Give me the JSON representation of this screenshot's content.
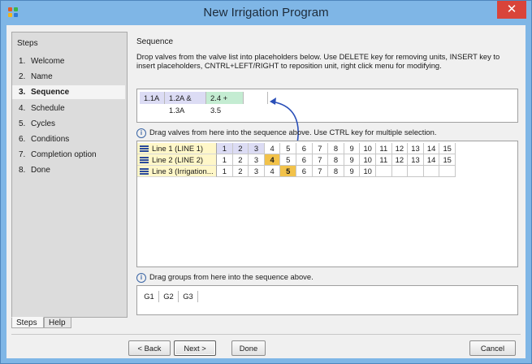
{
  "window": {
    "title": "New Irrigation Program",
    "close_icon": "✕",
    "title_bar_color": "#7fb6e6",
    "close_color": "#d9443a"
  },
  "steps": {
    "title": "Steps",
    "items": [
      {
        "num": "1.",
        "label": "Welcome",
        "active": false
      },
      {
        "num": "2.",
        "label": "Name",
        "active": false
      },
      {
        "num": "3.",
        "label": "Sequence",
        "active": true
      },
      {
        "num": "4.",
        "label": "Schedule",
        "active": false
      },
      {
        "num": "5.",
        "label": "Cycles",
        "active": false
      },
      {
        "num": "6.",
        "label": "Conditions",
        "active": false
      },
      {
        "num": "7.",
        "label": "Completion option",
        "active": false
      },
      {
        "num": "8.",
        "label": "Done",
        "active": false
      }
    ],
    "tabs": [
      {
        "label": "Steps",
        "selected": true
      },
      {
        "label": "Help",
        "selected": false
      }
    ]
  },
  "sequence": {
    "title": "Sequence",
    "instructions": "Drop valves from the valve list into placeholders below. Use DELETE key for removing units, INSERT key to insert placeholders, CNTRL+LEFT/RIGHT to reposition unit, right click menu for modifying.",
    "chips": [
      {
        "label": "1.1A",
        "color": "#dcdcf4"
      },
      {
        "label": "1.2A & 1.3A",
        "color": "#dcdcf4"
      },
      {
        "label": "2.4 + 3.5",
        "color": "#c4ecd2"
      }
    ]
  },
  "valves": {
    "hint": "Drag valves from here into the sequence above. Use CTRL key for multiple selection.",
    "highlight_color": "#f2c24a",
    "lines": [
      {
        "name": "Line 1 (LINE  1)",
        "cells": [
          "1",
          "2",
          "3",
          "4",
          "5",
          "6",
          "7",
          "8",
          "9",
          "10",
          "11",
          "12",
          "13",
          "14",
          "15"
        ],
        "highlight": -1,
        "lavender": [
          0,
          1,
          2
        ]
      },
      {
        "name": "Line 2 (LINE  2)",
        "cells": [
          "1",
          "2",
          "3",
          "4",
          "5",
          "6",
          "7",
          "8",
          "9",
          "10",
          "11",
          "12",
          "13",
          "14",
          "15"
        ],
        "highlight": 3,
        "lavender": []
      },
      {
        "name": "Line 3 (Irrigation...",
        "cells": [
          "1",
          "2",
          "3",
          "4",
          "5",
          "6",
          "7",
          "8",
          "9",
          "10",
          "",
          "",
          "",
          "",
          ""
        ],
        "highlight": 4,
        "lavender": []
      }
    ],
    "scroll_left_icon": "◀",
    "scroll_right_icon": "▶"
  },
  "groups": {
    "hint": "Drag groups from here into the sequence above.",
    "items": [
      "G1",
      "G2",
      "G3"
    ]
  },
  "buttons": {
    "back": "< Back",
    "next": "Next >",
    "done": "Done",
    "cancel": "Cancel"
  }
}
